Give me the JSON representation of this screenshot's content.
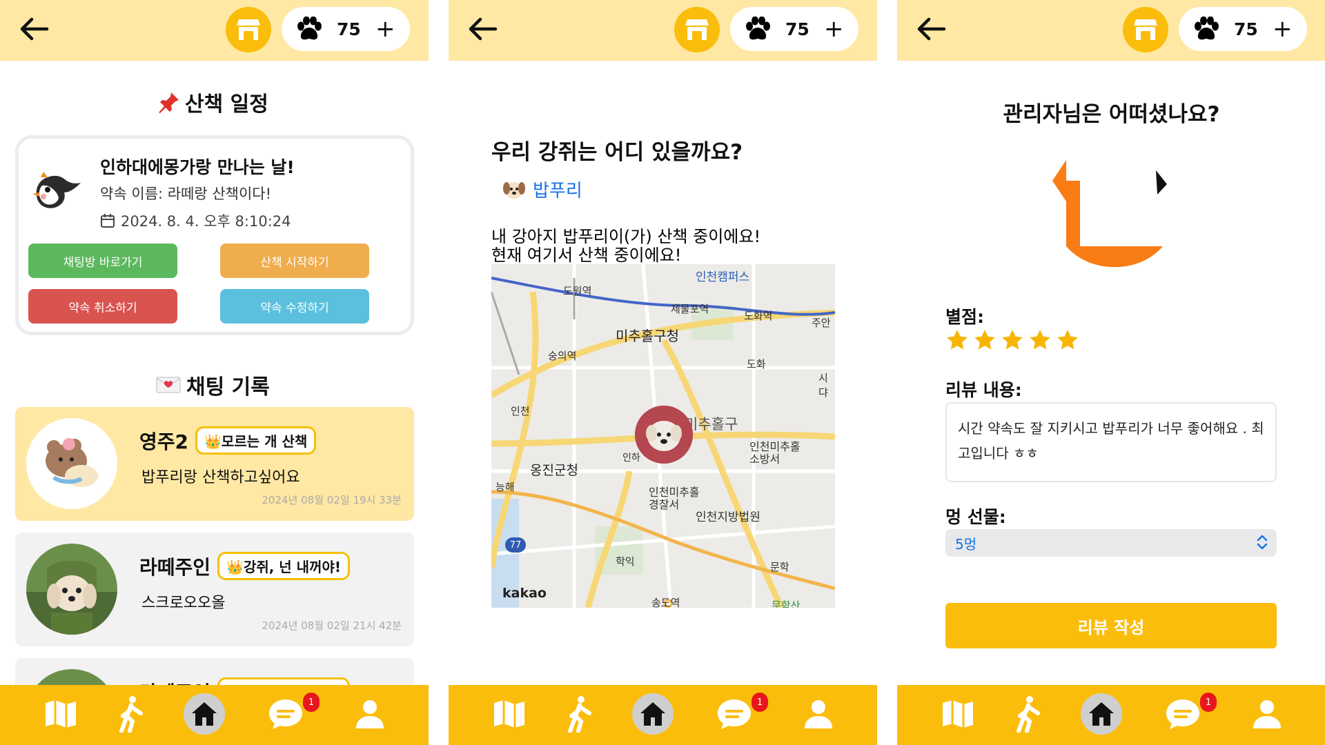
{
  "topbar": {
    "paw_count": "75",
    "plus": "+"
  },
  "bottom_nav": {
    "badge_count": "1"
  },
  "schedule_screen": {
    "section_title": "산책 일정",
    "appointment": {
      "title": "인하대에몽가랑 만나는 날!",
      "name_line": "약속 이름: 라떼랑 산책이다!",
      "datetime": "2024. 8. 4. 오후 8:10:24"
    },
    "buttons": {
      "chat": "채팅방 바로가기",
      "start_walk": "산책 시작하기",
      "cancel": "약속 취소하기",
      "edit": "약속 수정하기"
    },
    "chat_section_title": "채팅 기록",
    "chats": [
      {
        "name": "영주2",
        "tag": "👑모르는 개 산책",
        "message": "밥푸리랑 산책하고싶어요",
        "time": "2024년 08월 02일 19시 33분"
      },
      {
        "name": "라떼주인",
        "tag": "👑강쥐, 넌 내꺼야!",
        "message": "스크로오오올",
        "time": "2024년 08월 02일 21시 42분"
      },
      {
        "name": "라떼주인",
        "tag": "👑강쥐, 넌 내꺼야!"
      }
    ],
    "colors": {
      "chat_btn": "#5cb85c",
      "start_btn": "#f0ad4e",
      "cancel_btn": "#d9534f",
      "edit_btn": "#5bc0de"
    }
  },
  "location_screen": {
    "question": "우리 강쥐는 어디 있을까요?",
    "dog_name": "밥푸리",
    "status_line1": "내 강아지 밥푸리이(가) 산책 중이에요!",
    "status_line2": "현재 여기서 산책 중이에요!",
    "map_labels": {
      "dowon": "도원역",
      "jemulpo": "제물포역",
      "dohwa_st": "도화역",
      "juan": "주안",
      "campus": "인천캠퍼스",
      "michuhol_gu": "미추홀구청",
      "sunui": "숭의역",
      "dohwa_ic": "도화",
      "incheon_ic": "인천",
      "michuhol": "미추홀구",
      "fire": "인천미추홀\n소방서",
      "inha": "인하",
      "ongjin": "옹진군청",
      "neunghae": "능해",
      "police": "인천미추홀\n경찰서",
      "court": "인천지방법원",
      "hakik": "학익",
      "munhak": "문학",
      "munhaksan": "문학산",
      "songdo": "송도역",
      "sidae": "시댜",
      "route": "77",
      "brand": "kakao"
    }
  },
  "review_screen": {
    "question": "관리자님은 어떠셨나요?",
    "rating_label": "별점:",
    "rating": 5,
    "review_label": "리뷰 내용:",
    "review_text": "시간 약속도 잘 지키시고 밥푸리가 너무 좋어해요 . 최고입니다 ㅎㅎ",
    "gift_label": "멍 선물:",
    "gift_value": "5멍",
    "submit": "리뷰 작성"
  },
  "accent": "#fbbd0c",
  "topbar_bg": "#ffe8a3"
}
